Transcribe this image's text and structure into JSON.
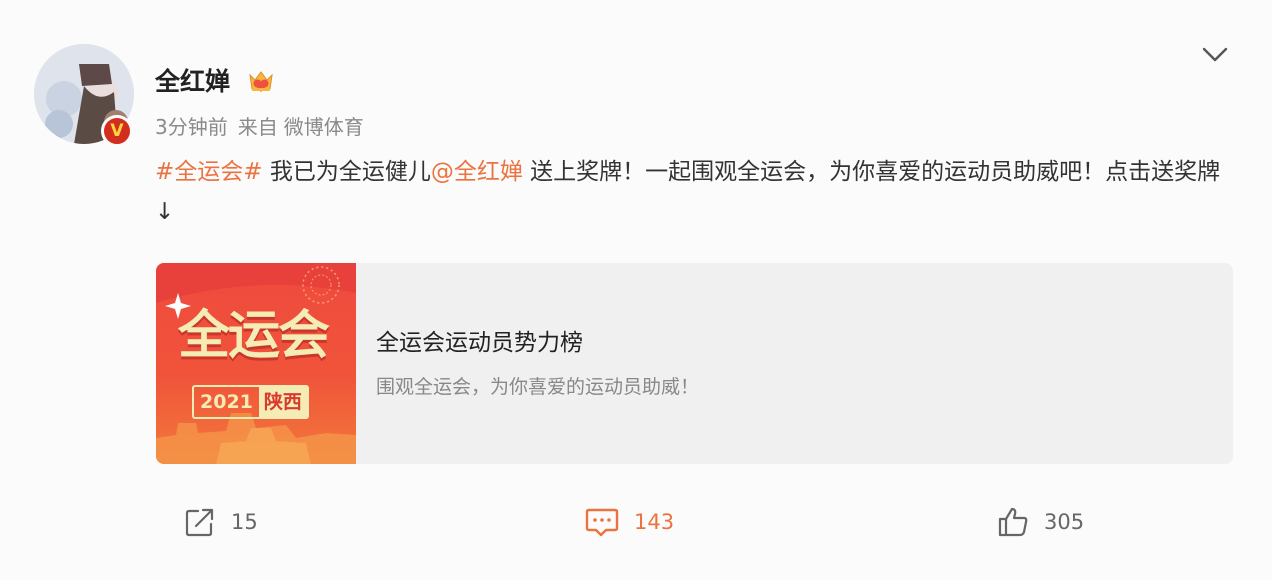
{
  "post": {
    "user": {
      "name": "全红婵",
      "verified_badge": "V",
      "crown_icon": "crown-icon"
    },
    "meta": {
      "time": "3分钟前",
      "source_prefix": "来自",
      "source": "微博体育"
    },
    "content": {
      "hashtag": "#全运会#",
      "text1": " 我已为全运健儿",
      "mention": "@全红婵",
      "text2": " 送上奖牌！一起围观全运会，为你喜爱的运动员助威吧！点击送奖牌↓"
    },
    "card": {
      "thumb_title": "全运会",
      "thumb_year": "2021",
      "thumb_place": "陕西",
      "title": "全运会运动员势力榜",
      "description": "围观全运会，为你喜爱的运动员助威！"
    },
    "actions": {
      "share_count": "15",
      "comment_count": "143",
      "like_count": "305"
    }
  },
  "colors": {
    "link": "#eb7340",
    "badge": "#d22e1f",
    "card_bg": "#f0f0f0",
    "thumb_red": "#ef4a3f"
  }
}
